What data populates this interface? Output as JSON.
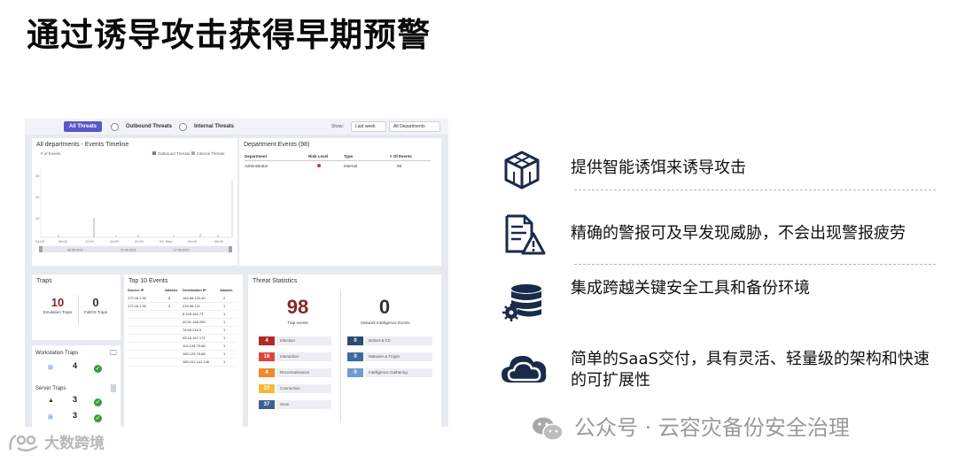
{
  "title": "通过诱导攻击获得早期预警",
  "dashboard": {
    "toolbar": {
      "all_threats": "All Threats",
      "outbound_threats": "Outbound Threats",
      "internal_threats": "Internal Threats",
      "show_label": "Show:",
      "period": "Last week",
      "department": "All Departments"
    },
    "timeline": {
      "title": "All departments - Events Timeline",
      "y_label": "# of Events",
      "legend_outbound": "Outbound Threats",
      "legend_internal": "Internal Threats"
    },
    "department_events": {
      "title": "Department Events (98)",
      "headers": [
        "Department",
        "Risk Level",
        "Type",
        "# Of Events"
      ],
      "rows": [
        [
          "Administrator",
          "",
          "Internal",
          "98"
        ]
      ]
    },
    "traps": {
      "title": "Traps",
      "emulation_count": "10",
      "emulation_label": "Emulation Traps",
      "fullos_count": "0",
      "fullos_label": "FullOS Traps"
    },
    "workstation_traps": {
      "title": "Workstation Traps",
      "windows_count": "4"
    },
    "server_traps": {
      "title": "Server Traps",
      "linux_count": "3",
      "windows_count": "3"
    },
    "top10": {
      "title": "Top 10 Events",
      "headers": [
        "Source IP",
        "Attacks",
        "Destination IP",
        "Attacks"
      ],
      "rows": [
        [
          "172.18.1.90",
          "8",
          "164.68.122.40",
          "2"
        ],
        [
          "172.18.1.90",
          "4",
          "218.96.121",
          "1"
        ],
        [
          "",
          "",
          "8.106.182.73",
          "1"
        ],
        [
          "",
          "",
          "40.91.168.255",
          "1"
        ],
        [
          "",
          "",
          "78.65.216.5",
          "1"
        ],
        [
          "",
          "",
          "95.16.157.172",
          "1"
        ],
        [
          "",
          "",
          "104.144.79.86",
          "1"
        ],
        [
          "",
          "",
          "165.129.79.86",
          "1"
        ],
        [
          "",
          "",
          "185.101.141.146",
          "1"
        ]
      ]
    },
    "threat_stats": {
      "title": "Threat Statistics",
      "trap_count": "98",
      "trap_label": "Trap events",
      "network_count": "0",
      "network_label": "Network Intelligence Events",
      "left_items": [
        {
          "count": "4",
          "label": "Infection",
          "color": "#b22a25"
        },
        {
          "count": "16",
          "label": "Interaction",
          "color": "#e0453d"
        },
        {
          "count": "4",
          "label": "Reconnaissance",
          "color": "#ee8a2a"
        },
        {
          "count": "37",
          "label": "Connection",
          "color": "#f5b93a"
        },
        {
          "count": "37",
          "label": "Scan",
          "color": "#3c5f8f"
        }
      ],
      "right_items": [
        {
          "count": "0",
          "label": "Botnet & CC",
          "color": "#2d4b73"
        },
        {
          "count": "0",
          "label": "Malware & Trojan",
          "color": "#3d6aa3"
        },
        {
          "count": "0",
          "label": "Intelligence Gathering",
          "color": "#6f9bd1"
        }
      ]
    }
  },
  "features": [
    {
      "icon": "cube-icon",
      "text": "提供智能诱饵来诱导攻击"
    },
    {
      "icon": "document-warning-icon",
      "text": "精确的警报可及早发现威胁，不会出现警报疲劳"
    },
    {
      "icon": "database-gear-icon",
      "text": "集成跨越关键安全工具和备份环境"
    },
    {
      "icon": "cloud-icon",
      "text": "简单的SaaS交付，具有灵活、轻量级的架构和快速的可扩展性"
    }
  ],
  "watermark": "公众号 · 云容灾备份安全治理",
  "logo_text": "大数跨境"
}
